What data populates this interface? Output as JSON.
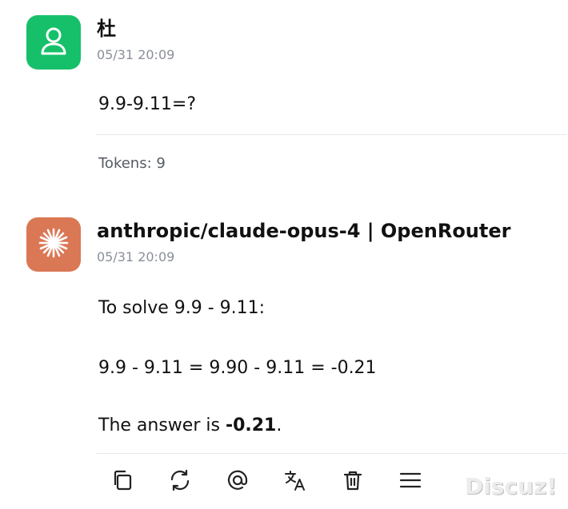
{
  "messages": [
    {
      "role": "user",
      "sender": "杜",
      "time": "05/31 20:09",
      "text": "9.9-9.11=?",
      "tokens": "Tokens: 9",
      "avatar_icon": "user-icon",
      "avatar_color": "#16c06a"
    },
    {
      "role": "assistant",
      "sender": "anthropic/claude-opus-4 | OpenRouter",
      "time": "05/31 20:09",
      "lines": {
        "line1": "To solve 9.9 - 9.11:",
        "line2": "9.9 - 9.11 = 9.90 - 9.11 = -0.21",
        "line3_prefix": "The answer is ",
        "line3_bold": "-0.21",
        "line3_suffix": "."
      },
      "avatar_icon": "claude-starburst-icon",
      "avatar_color": "#da7755"
    }
  ],
  "toolbar": {
    "icons": [
      "copy-icon",
      "regenerate-icon",
      "mention-icon",
      "translate-icon",
      "delete-icon",
      "menu-icon"
    ]
  },
  "watermark": "Discuz!"
}
